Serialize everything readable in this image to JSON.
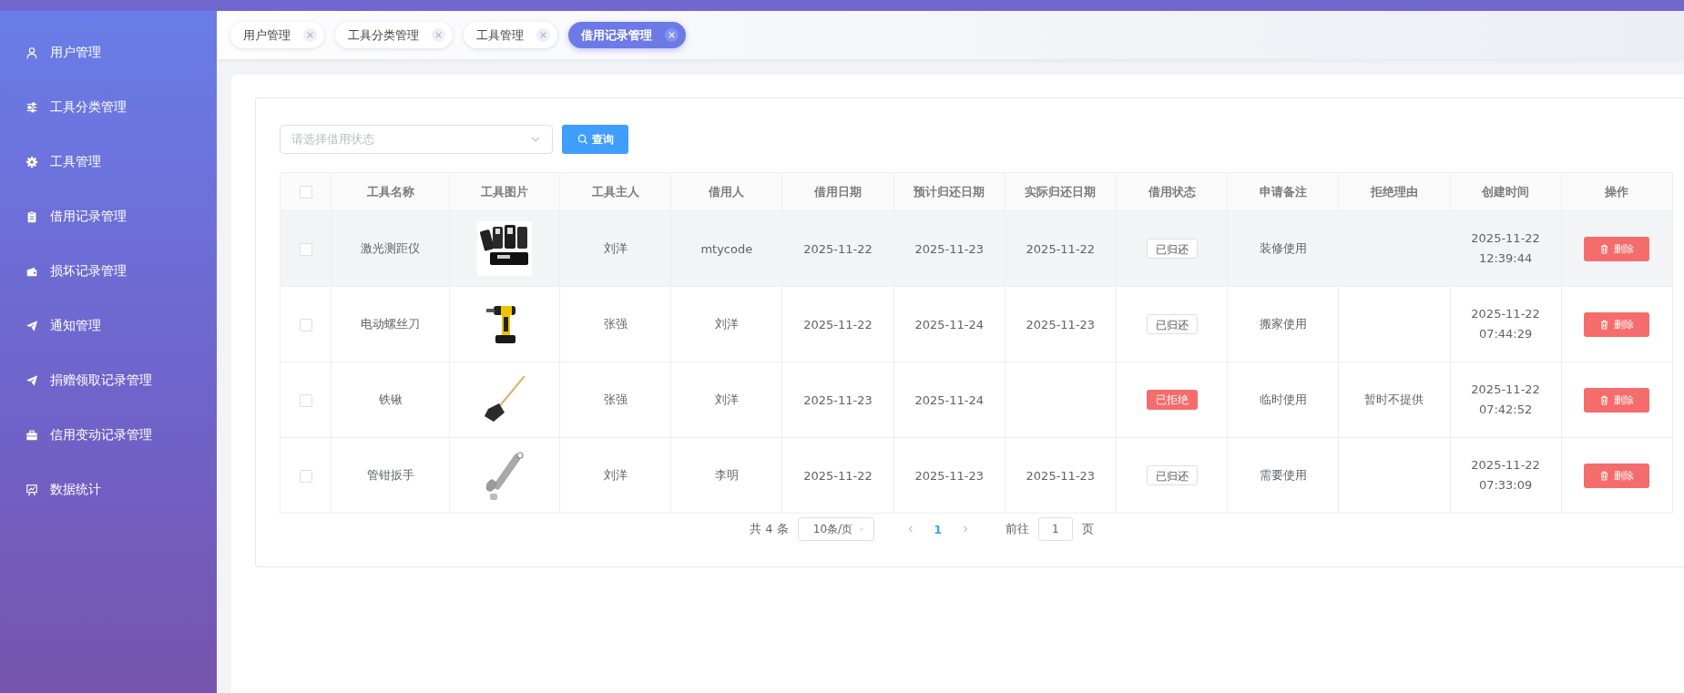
{
  "sidebar": {
    "items": [
      {
        "label": "用户管理"
      },
      {
        "label": "工具分类管理"
      },
      {
        "label": "工具管理"
      },
      {
        "label": "借用记录管理"
      },
      {
        "label": "损坏记录管理"
      },
      {
        "label": "通知管理"
      },
      {
        "label": "捐赠领取记录管理"
      },
      {
        "label": "信用变动记录管理"
      },
      {
        "label": "数据统计"
      }
    ]
  },
  "tabs": [
    {
      "label": "用户管理",
      "selected": false
    },
    {
      "label": "工具分类管理",
      "selected": false
    },
    {
      "label": "工具管理",
      "selected": false
    },
    {
      "label": "借用记录管理",
      "selected": true
    }
  ],
  "filter": {
    "placeholder": "请选择借用状态",
    "button": "查询"
  },
  "table": {
    "select_all": {
      "checked": false
    },
    "columns": [
      "工具名称",
      "工具图片",
      "工具主人",
      "借用人",
      "借用日期",
      "预计归还日期",
      "实际归还日期",
      "借用状态",
      "申请备注",
      "拒绝理由",
      "创建时间",
      "操作"
    ],
    "rows": [
      {
        "checked": false,
        "highlighted": true,
        "name": "激光测距仪",
        "owner": "刘洋",
        "borrower": "mtycode",
        "borrow_date": "2025-11-22",
        "expected_return": "2025-11-23",
        "actual_return": "2025-11-22",
        "status": {
          "label": "已归还",
          "kind": "returned"
        },
        "note": "装修使用",
        "reject_reason": "",
        "created": "2025-11-22 12:39:44",
        "action": "删除"
      },
      {
        "checked": false,
        "highlighted": false,
        "name": "电动螺丝刀",
        "owner": "张强",
        "borrower": "刘洋",
        "borrow_date": "2025-11-22",
        "expected_return": "2025-11-24",
        "actual_return": "2025-11-23",
        "status": {
          "label": "已归还",
          "kind": "returned"
        },
        "note": "搬家使用",
        "reject_reason": "",
        "created": "2025-11-22 07:44:29",
        "action": "删除"
      },
      {
        "checked": false,
        "highlighted": false,
        "name": "铁锹",
        "owner": "张强",
        "borrower": "刘洋",
        "borrow_date": "2025-11-23",
        "expected_return": "2025-11-24",
        "actual_return": "",
        "status": {
          "label": "已拒绝",
          "kind": "rejected"
        },
        "note": "临时使用",
        "reject_reason": "暂时不提供",
        "created": "2025-11-22 07:42:52",
        "action": "删除"
      },
      {
        "checked": false,
        "highlighted": false,
        "name": "管钳扳手",
        "owner": "刘洋",
        "borrower": "李明",
        "borrow_date": "2025-11-22",
        "expected_return": "2025-11-23",
        "actual_return": "2025-11-23",
        "status": {
          "label": "已归还",
          "kind": "returned"
        },
        "note": "需要使用",
        "reject_reason": "",
        "created": "2025-11-22 07:33:09",
        "action": "删除"
      }
    ]
  },
  "pagination": {
    "total": "共 4 条",
    "page_size": "10条/页",
    "pages": [
      {
        "label": "1",
        "selected": true
      }
    ],
    "goto_label": "前往",
    "goto_value": "1",
    "goto_suffix": "页"
  }
}
